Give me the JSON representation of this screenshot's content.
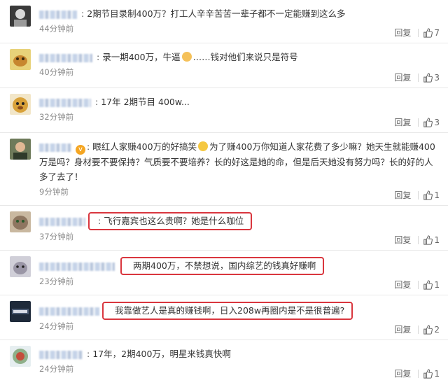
{
  "comments": [
    {
      "sep": ":",
      "text": "2期节目录制400万？打工人辛辛苦苦一辈子都不一定能赚到这么多",
      "time": "44分钟前",
      "reply": "回复",
      "likes": "7"
    },
    {
      "sep": ":",
      "text_a": "录一期400万，牛逼",
      "text_b": "……钱对他们来说只是符号",
      "time": "40分钟前",
      "reply": "回复",
      "likes": "3"
    },
    {
      "sep": ":",
      "text": "17年 2期节目 400w...",
      "time": "32分钟前",
      "reply": "回复",
      "likes": "3"
    },
    {
      "sep": ":",
      "text_a": "眼红人家赚400万的好搞笑",
      "text_b": "为了赚400万你知道人家花费了多少嘛？她天生就能赚400万是吗？身材要不要保持？气质要不要培养？长的好这是她的命，但是后天她没有努力吗？长的好的人多了去了！",
      "time": "9分钟前",
      "reply": "回复",
      "likes": "1"
    },
    {
      "sep": ":",
      "text": "飞行嘉宾也这么贵啊？她是什么咖位",
      "time": "37分钟前",
      "reply": "回复",
      "likes": "1"
    },
    {
      "sep": "",
      "text": "两期400万，不禁想说，国内综艺的钱真好赚啊",
      "time": "23分钟前",
      "reply": "回复",
      "likes": "1"
    },
    {
      "sep": "",
      "text": "我靠做艺人是真的赚钱啊，日入208w再圈内是不是很普遍?",
      "time": "24分钟前",
      "reply": "回复",
      "likes": "2"
    },
    {
      "sep": ":",
      "text": "17年，2期400万，明星来钱真快啊",
      "time": "24分钟前",
      "reply": "回复",
      "likes": "1"
    }
  ],
  "colors": {
    "highlight": "#d9363e",
    "time": "#8a8a8a",
    "blur_name": "#c5d3e8"
  },
  "icons": {
    "like": "thumbs-up-icon",
    "vip": "vip-badge-icon"
  }
}
